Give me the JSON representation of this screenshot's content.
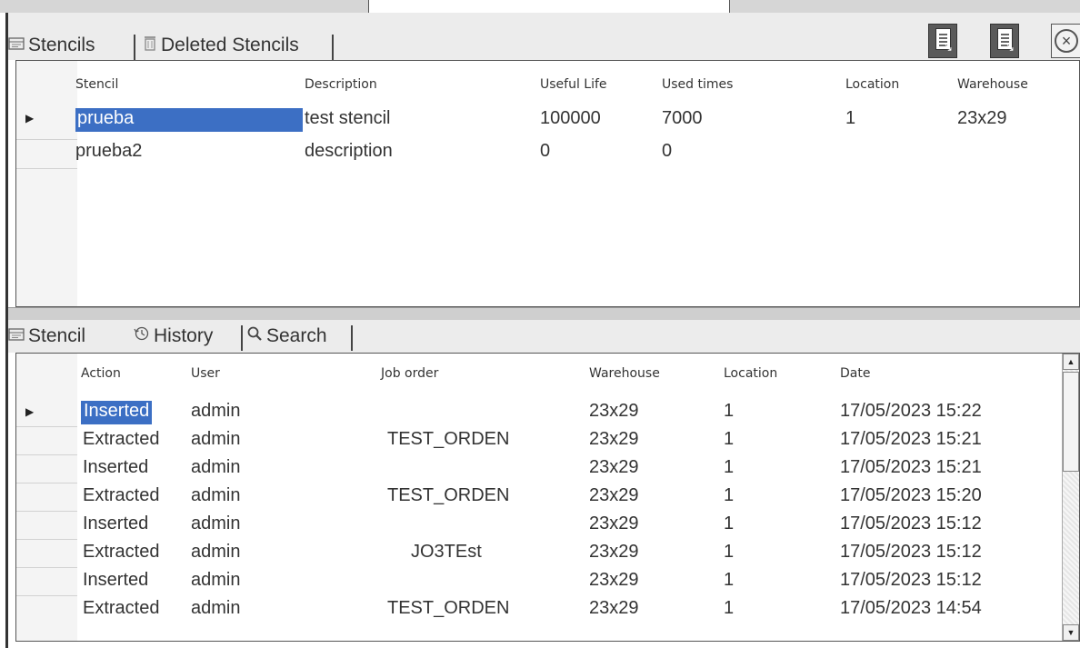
{
  "upper_tabs": [
    {
      "label": "Stencils",
      "icon": "stencil-icon"
    },
    {
      "label": "Deleted Stencils",
      "icon": "trash-icon"
    }
  ],
  "toolbar": {
    "buttons": [
      "report-icon",
      "export-icon",
      "close-icon"
    ]
  },
  "stencils_table": {
    "columns": [
      "Stencil",
      "Description",
      "Useful Life",
      "Used times",
      "Location",
      "Warehouse"
    ],
    "rows": [
      [
        "prueba",
        "test stencil",
        "100000",
        "7000",
        "1",
        "23x29"
      ],
      [
        "prueba2",
        "description",
        "0",
        "0",
        "",
        ""
      ]
    ],
    "selected_row": 0
  },
  "lower_tabs": [
    {
      "label": "Stencil",
      "icon": "stencil-icon"
    },
    {
      "label": "History",
      "icon": "history-icon"
    },
    {
      "label": "Search",
      "icon": "search-icon"
    }
  ],
  "history_table": {
    "columns": [
      "Action",
      "User",
      "Job order",
      "Warehouse",
      "Location",
      "Date"
    ],
    "rows": [
      [
        "Inserted",
        "admin",
        "",
        "23x29",
        "1",
        "17/05/2023 15:22"
      ],
      [
        "Extracted",
        "admin",
        "TEST_ORDEN",
        "23x29",
        "1",
        "17/05/2023 15:21"
      ],
      [
        "Inserted",
        "admin",
        "",
        "23x29",
        "1",
        "17/05/2023 15:21"
      ],
      [
        "Extracted",
        "admin",
        "TEST_ORDEN",
        "23x29",
        "1",
        "17/05/2023 15:20"
      ],
      [
        "Inserted",
        "admin",
        "",
        "23x29",
        "1",
        "17/05/2023 15:12"
      ],
      [
        "Extracted",
        "admin",
        "JO3TEst",
        "23x29",
        "1",
        "17/05/2023 15:12"
      ],
      [
        "Inserted",
        "admin",
        "",
        "23x29",
        "1",
        "17/05/2023 15:12"
      ],
      [
        "Extracted",
        "admin",
        "TEST_ORDEN",
        "23x29",
        "1",
        "17/05/2023 14:54"
      ]
    ],
    "selected_row": 0
  },
  "colors": {
    "selection": "#3c6fc4",
    "chrome": "#ececec"
  }
}
